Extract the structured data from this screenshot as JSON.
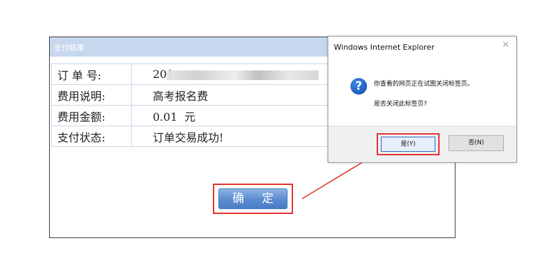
{
  "panel": {
    "title": "支付结果",
    "rows": [
      {
        "label": "订 单 号:",
        "value": "201"
      },
      {
        "label": "费用说明:",
        "value": "高考报名费"
      },
      {
        "label": "费用金额:",
        "value": "0.01  元"
      },
      {
        "label": "支付状态:",
        "value": "订单交易成功!"
      }
    ],
    "confirm_label": "确 定"
  },
  "dialog": {
    "title": "Windows Internet Explorer",
    "close": "✕",
    "icon": "question-icon",
    "icon_glyph": "?",
    "message_line1": "你查看的网页正在试图关闭标签页。",
    "message_line2": "是否关闭此标签页?",
    "yes_label": "是(Y)",
    "no_label": "否(N)"
  },
  "colors": {
    "highlight": "#e0332b",
    "header": "#c7d8ee",
    "button": "#5b8bd0"
  }
}
